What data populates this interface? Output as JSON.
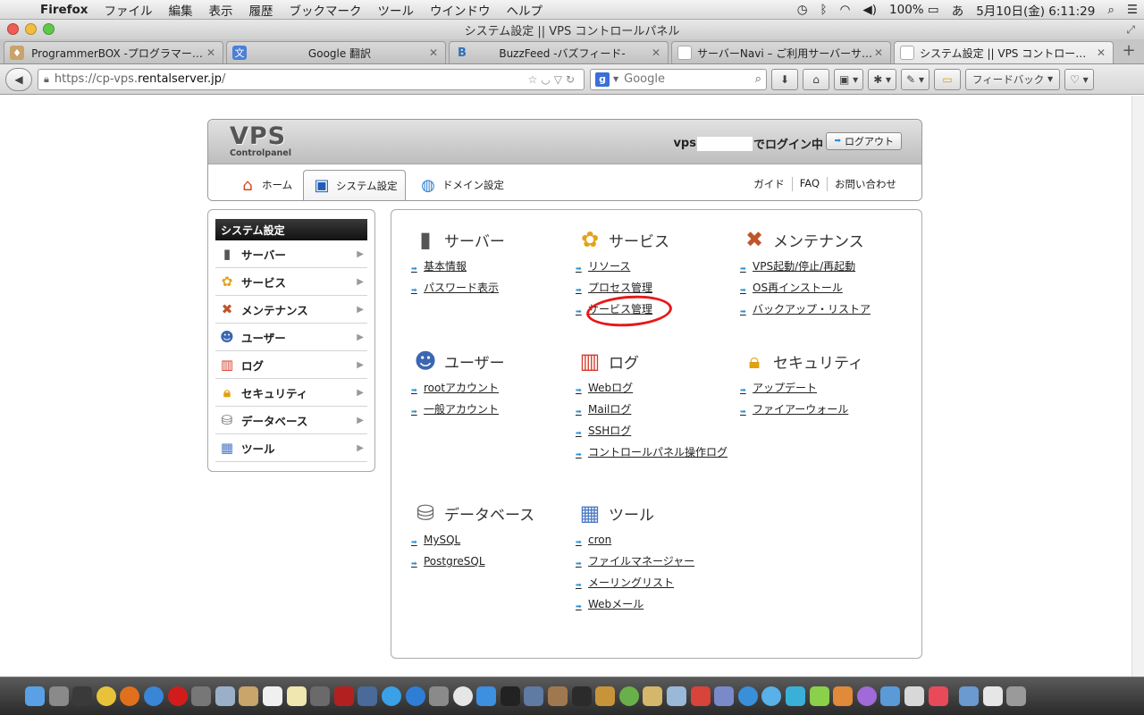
{
  "menubar": {
    "app": "Firefox",
    "items": [
      "ファイル",
      "編集",
      "表示",
      "履歴",
      "ブックマーク",
      "ツール",
      "ウインドウ",
      "ヘルプ"
    ],
    "battery": "100%",
    "ime": "あ",
    "clock": "5月10日(金)  6:11:29"
  },
  "window": {
    "title": "システム設定 || VPS コントロールパネル"
  },
  "tabs": [
    {
      "label": "ProgrammerBOX -プログラマー…",
      "color": "#c8a36a"
    },
    {
      "label": "Google 翻訳",
      "color": "#4d7fd6"
    },
    {
      "label": "BuzzFeed -バズフィード-",
      "color": "#2e6fbd"
    },
    {
      "label": "サーバーNavi – ご利用サーバーサ…",
      "color": "#e0e0e0"
    },
    {
      "label": "システム設定 || VPS コントロール…",
      "color": "#e8e8e8"
    }
  ],
  "toolbar": {
    "url_prefix": "https://cp-vps.",
    "url_domain": "rentalserver.jp",
    "url_suffix": "/",
    "search_placeholder": "Google",
    "feedback_label": "フィードバック"
  },
  "header": {
    "logo_big": "VPS",
    "logo_small": "Controlpanel",
    "login_prefix": "vps",
    "login_suffix": "でログイン中",
    "logout_label": "ログアウト"
  },
  "nav": {
    "tabs": [
      {
        "label": "ホーム"
      },
      {
        "label": "システム設定"
      },
      {
        "label": "ドメイン設定"
      }
    ],
    "links": [
      "ガイド",
      "FAQ",
      "お問い合わせ"
    ]
  },
  "sidebar": {
    "title": "システム設定",
    "items": [
      "サーバー",
      "サービス",
      "メンテナンス",
      "ユーザー",
      "ログ",
      "セキュリティ",
      "データベース",
      "ツール"
    ]
  },
  "sections": [
    {
      "title": "サーバー",
      "links": [
        "基本情報",
        "パスワード表示"
      ]
    },
    {
      "title": "サービス",
      "links": [
        "リソース",
        "プロセス管理",
        "サービス管理"
      ]
    },
    {
      "title": "メンテナンス",
      "links": [
        "VPS起動/停止/再起動",
        "OS再インストール",
        "バックアップ・リストア"
      ]
    },
    {
      "title": "ユーザー",
      "links": [
        "rootアカウント",
        "一般アカウント"
      ]
    },
    {
      "title": "ログ",
      "links": [
        "Webログ",
        "Mailログ",
        "SSHログ",
        "コントロールパネル操作ログ"
      ]
    },
    {
      "title": "セキュリティ",
      "links": [
        "アップデート",
        "ファイアーウォール"
      ]
    },
    {
      "title": "データベース",
      "links": [
        "MySQL",
        "PostgreSQL"
      ]
    },
    {
      "title": "ツール",
      "links": [
        "cron",
        "ファイルマネージャー",
        "メーリングリスト",
        "Webメール"
      ]
    }
  ],
  "colors": {
    "link_arrow": "#2a8fd0",
    "highlight": "#e81818",
    "sidebar_title_bg": "#111111"
  }
}
